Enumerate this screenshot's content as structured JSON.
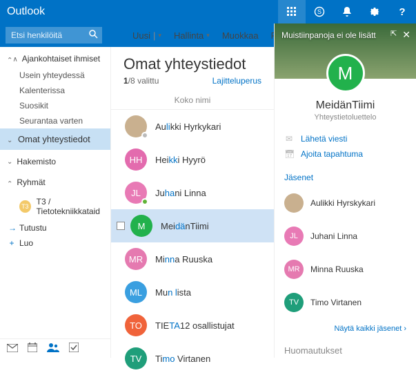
{
  "brand": "Outlook",
  "search": {
    "placeholder": "Etsi henkilöitä"
  },
  "toolbar": {
    "new_label": "Uusi",
    "manage_label": "Hallinta",
    "edit_label": "Muokkaa",
    "delete_label": "Poista"
  },
  "nav": {
    "relevant": {
      "title": "Ajankohtaiset ihmiset",
      "items": [
        "Usein yhteydessä",
        "Kalenterissa",
        "Suosikit",
        "Seurantaa varten"
      ]
    },
    "own_contacts": "Omat yhteystiedot",
    "directory": "Hakemisto",
    "groups": {
      "title": "Ryhmät",
      "items": [
        {
          "abbr": "T3",
          "label": "T3 / Tietotekniikkataid"
        }
      ]
    },
    "actions": {
      "explore": "Tutustu",
      "create": "Luo"
    }
  },
  "list": {
    "title": "Omat yhteystiedot",
    "selected_count": "1",
    "selected_sep": "/",
    "total_count": "8",
    "selected_word": "valittu",
    "sort_label": "Lajitteluperus",
    "column": "Koko nimi",
    "rows": [
      {
        "avatar_type": "photo",
        "initials": "",
        "bg": "#c9b08f",
        "presence": "#bbb",
        "name_pre": "Au",
        "name_hl": "li",
        "name_post": "kki Hyrkykari"
      },
      {
        "avatar_type": "initials",
        "initials": "HH",
        "bg": "#e36bae",
        "presence": "",
        "name_pre": "Hei",
        "name_hl": "kk",
        "name_post": "i Hyyrö"
      },
      {
        "avatar_type": "initials",
        "initials": "JL",
        "bg": "#e87ab5",
        "presence": "#5fb336",
        "name_pre": "Ju",
        "name_hl": "ha",
        "name_post": "ni Linna"
      },
      {
        "avatar_type": "initials",
        "initials": "M",
        "bg": "#22b14c",
        "presence": "",
        "name_pre": "Mei",
        "name_hl": "dä",
        "name_post": "nTiimi",
        "selected": true
      },
      {
        "avatar_type": "initials",
        "initials": "MR",
        "bg": "#e57ab0",
        "presence": "",
        "name_pre": "Mi",
        "name_hl": "nn",
        "name_post": "a Ruuska"
      },
      {
        "avatar_type": "initials",
        "initials": "ML",
        "bg": "#3a9fe0",
        "presence": "",
        "name_pre": "Mu",
        "name_hl": "n l",
        "name_post": "ista"
      },
      {
        "avatar_type": "initials",
        "initials": "TO",
        "bg": "#f0633a",
        "presence": "",
        "name_pre": "TIE",
        "name_hl": "TA",
        "name_post": "12 osallistujat"
      },
      {
        "avatar_type": "initials",
        "initials": "TV",
        "bg": "#1f9e7a",
        "presence": "",
        "name_pre": "Ti",
        "name_hl": "mo",
        "name_post": " Virtanen"
      }
    ]
  },
  "detail": {
    "hero_note": "Muistiinpanoja ei ole lisätt",
    "initial": "M",
    "name": "MeidänTiimi",
    "subtitle": "Yhteystietoluettelo",
    "actions": {
      "send": "Lähetä viesti",
      "schedule": "Ajoita tapahtuma"
    },
    "members_title": "Jäsenet",
    "members": [
      {
        "type": "photo",
        "initials": "",
        "bg": "#c9b08f",
        "name": "Aulikki Hyrskykari"
      },
      {
        "type": "initials",
        "initials": "JL",
        "bg": "#e87ab5",
        "name": "Juhani Linna"
      },
      {
        "type": "initials",
        "initials": "MR",
        "bg": "#e57ab0",
        "name": "Minna Ruuska"
      },
      {
        "type": "initials",
        "initials": "TV",
        "bg": "#1f9e7a",
        "name": "Timo Virtanen"
      }
    ],
    "show_all": "Näytä kaikki jäsenet",
    "notes_title": "Huomautukset"
  },
  "colors": {
    "brand": "#0072c6"
  }
}
